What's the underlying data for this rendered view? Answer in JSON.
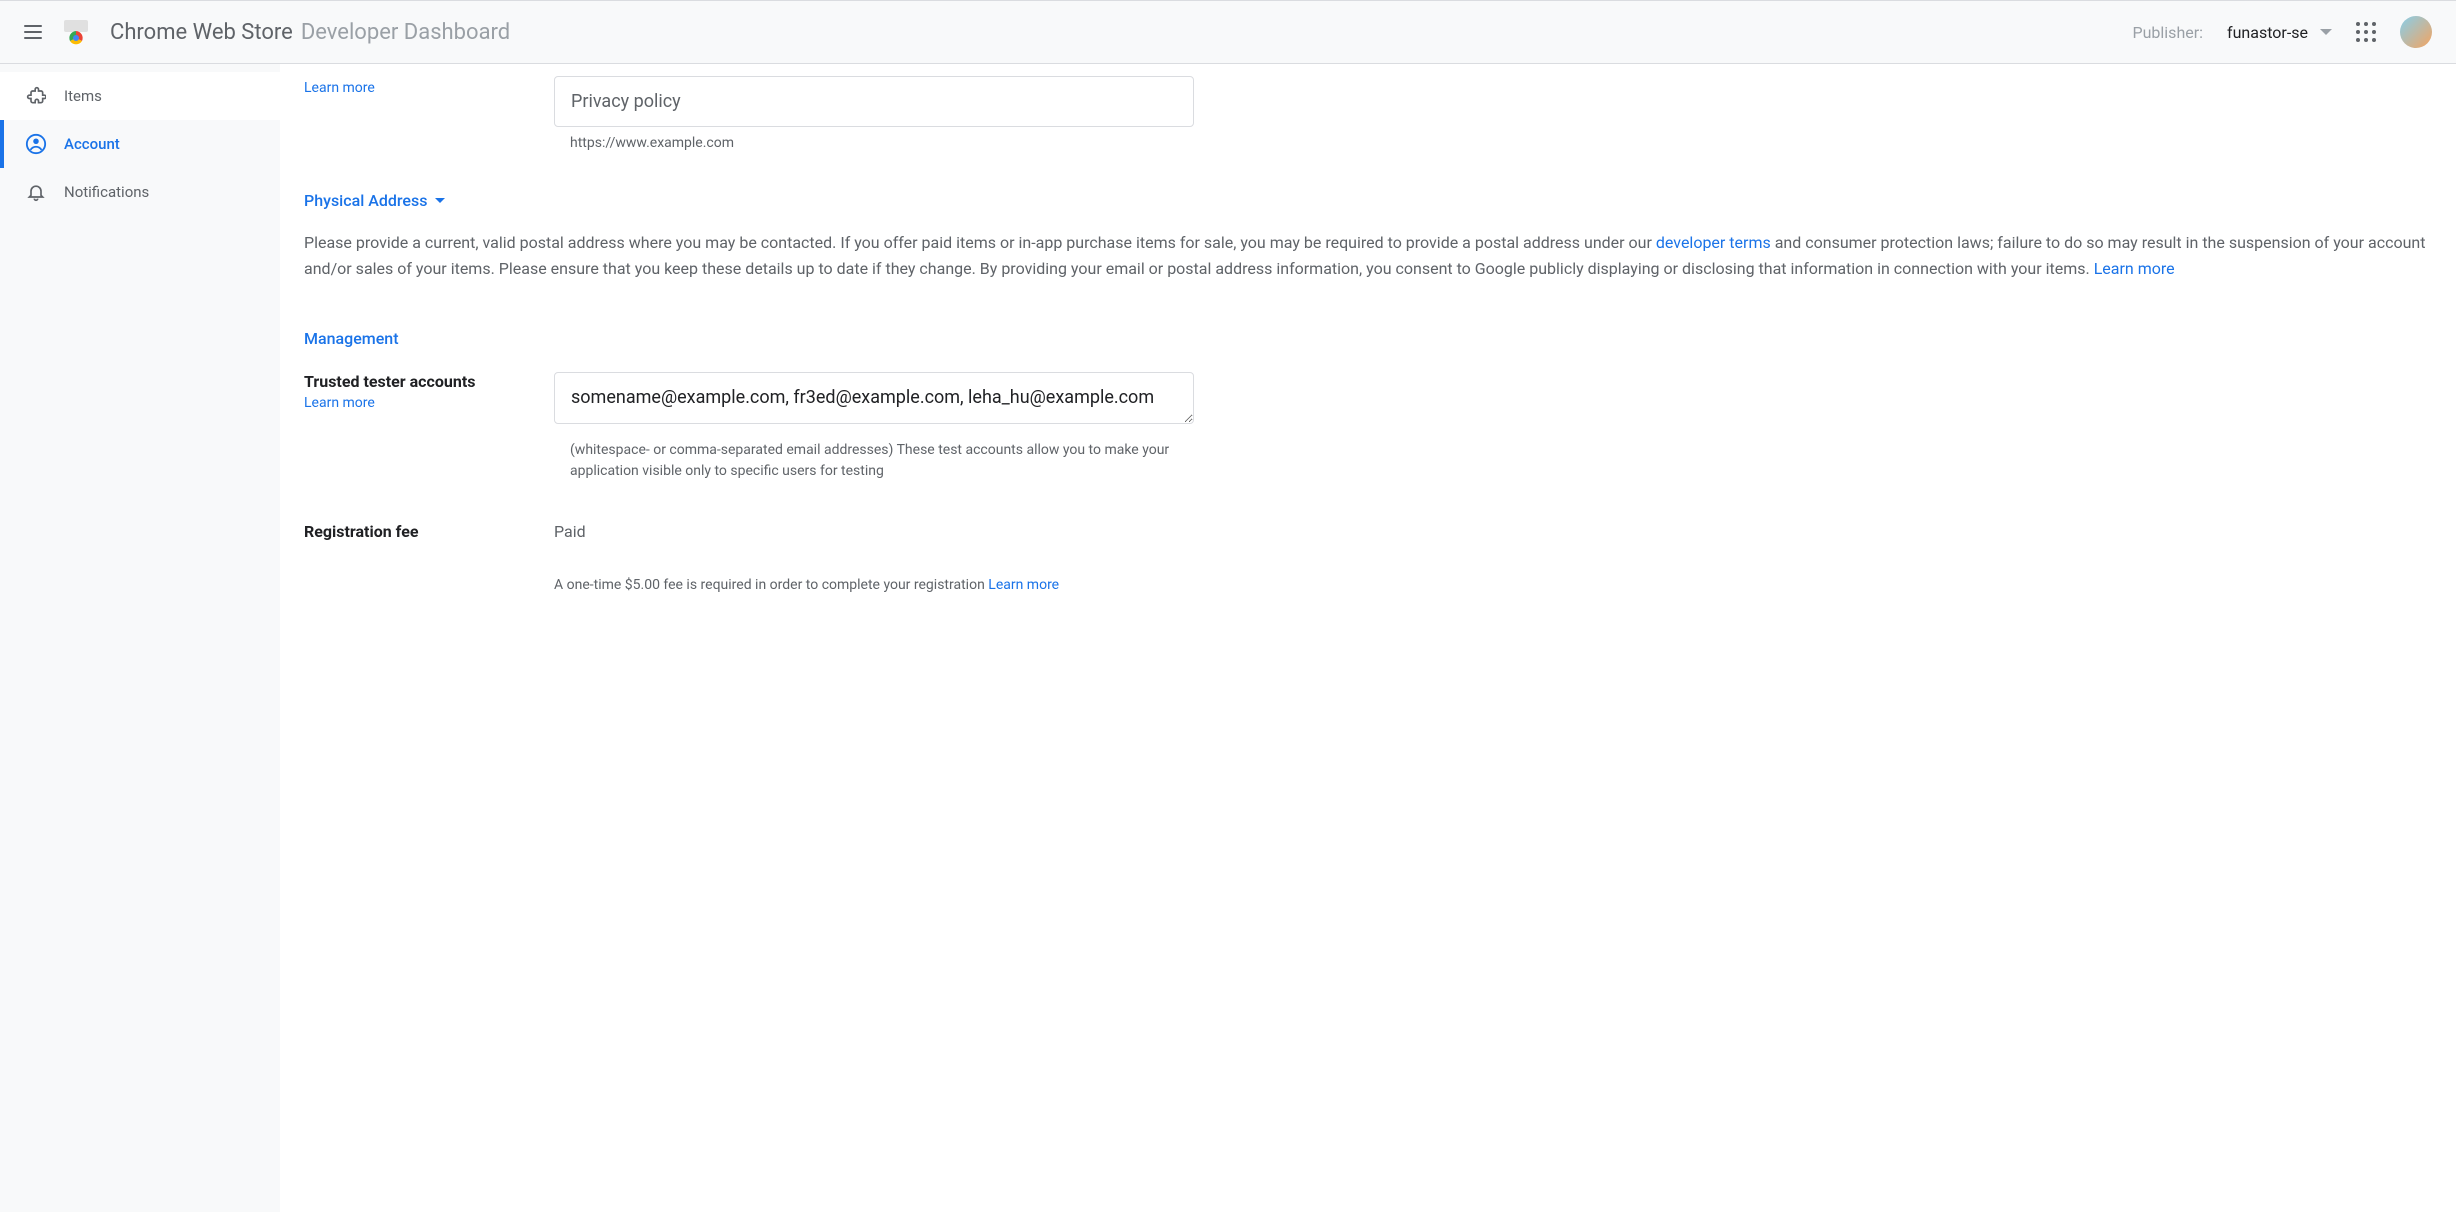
{
  "header": {
    "title_main": "Chrome Web Store",
    "title_sub": "Developer Dashboard",
    "publisher_label": "Publisher:",
    "publisher_value": "funastor-se"
  },
  "sidebar": {
    "items": [
      {
        "label": "Items"
      },
      {
        "label": "Account"
      },
      {
        "label": "Notifications"
      }
    ]
  },
  "content": {
    "privacy": {
      "learn_more": "Learn more",
      "placeholder": "Privacy policy",
      "helper": "https://www.example.com"
    },
    "physical_address": {
      "title": "Physical Address",
      "body_1": "Please provide a current, valid postal address where you may be contacted. If you offer paid items or in-app purchase items for sale, you may be required to provide a postal address under our ",
      "link_1": "developer terms",
      "body_2": " and consumer protection laws; failure to do so may result in the suspension of your account and/or sales of your items. Please ensure that you keep these details up to date if they change. By providing your email or postal address information, you consent to Google publicly displaying or disclosing that information in connection with your items. ",
      "link_2": "Learn more"
    },
    "management": {
      "title": "Management",
      "trusted_label": "Trusted tester accounts",
      "trusted_learn": "Learn more",
      "trusted_value": "somename@example.com, fr3ed@example.com, leha_hu@example.com",
      "trusted_helper": "(whitespace- or comma-separated email addresses) These test accounts allow you to make your application visible only to specific users for testing",
      "fee_label": "Registration fee",
      "fee_value": "Paid",
      "fee_helper": "A one-time $5.00 fee is required in order to complete your registration ",
      "fee_link": "Learn more"
    }
  }
}
